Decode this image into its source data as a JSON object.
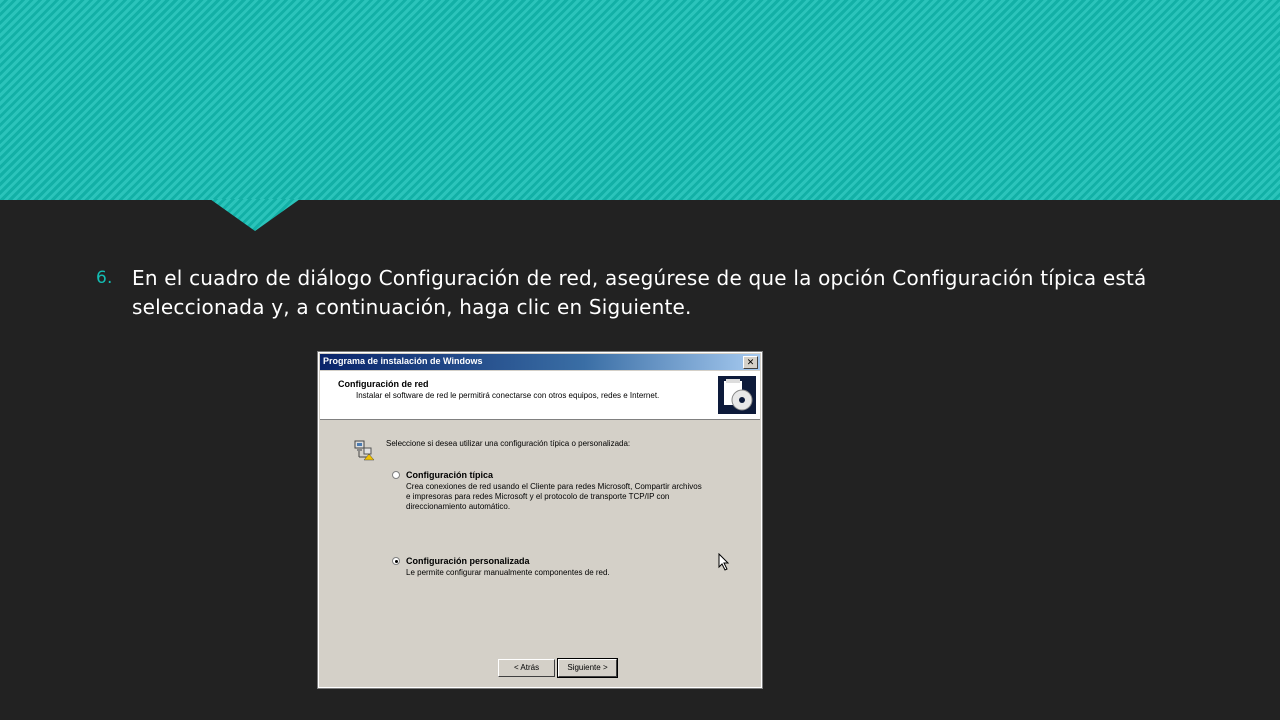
{
  "slide": {
    "step_number": "6.",
    "instruction": "En el cuadro de diálogo Configuración de red, asegúrese de que la opción Configuración típica está seleccionada y, a continuación, haga clic en Siguiente."
  },
  "dialog": {
    "title": "Programa de instalación de Windows",
    "close_glyph": "✕",
    "header_title": "Configuración de red",
    "header_subtitle": "Instalar el software de red le permitirá conectarse con otros equipos, redes e Internet.",
    "prompt": "Seleccione si desea utilizar una configuración típica o personalizada:",
    "options": [
      {
        "label": "Configuración típica",
        "description": "Crea conexiones de red usando el Cliente para redes Microsoft, Compartir archivos e impresoras para redes Microsoft y el protocolo de transporte TCP/IP con direccionamiento automático.",
        "selected": false
      },
      {
        "label": "Configuración personalizada",
        "description": "Le permite configurar manualmente componentes de red.",
        "selected": true
      }
    ],
    "back_button": "< Atrás",
    "next_button": "Siguiente >"
  },
  "colors": {
    "accent": "#13bdb3",
    "background": "#222222",
    "dialog_face": "#d4d0c8",
    "titlebar": "#0a246a"
  },
  "icons": [
    "network-setup-icon",
    "setup-cd-icon",
    "mouse-cursor-icon"
  ]
}
